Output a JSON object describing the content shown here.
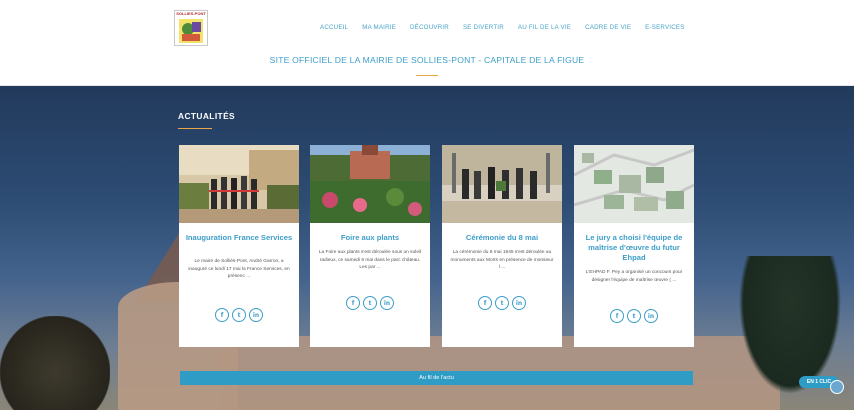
{
  "header": {
    "logo_text": "SOLLIES-PONT",
    "nav": [
      "ACCUEIL",
      "MA MAIRIE",
      "DÉCOUVRIR",
      "SE DIVERTIR",
      "AU FIL DE LA VIE",
      "CADRE DE VIE",
      "E-SERVICES"
    ],
    "site_title": "SITE OFFICIEL DE LA MAIRIE DE SOLLIES-PONT - CAPITALE DE LA FIGUE"
  },
  "news": {
    "section_title": "ACTUALITÉS",
    "cards": [
      {
        "title": "Inauguration France Services",
        "excerpt": "Le maire de Solliès-Pont, André Garron, a inauguré ce lundi 17 mai la France Services, en présenc ...",
        "image": "inauguration-photo"
      },
      {
        "title": "Foire aux plants",
        "excerpt": "La Foire aux plants s'est déroulée sous un soleil radieux, ce samedi 8 mai dans le parc château. Les par ...",
        "image": "garden-photo"
      },
      {
        "title": "Cérémonie du 8 mai",
        "excerpt": "La cérémonie du 8 mai 1945 s'est déroulée au monuments aux Morts en présence de monsieur l ...",
        "image": "ceremony-photo"
      },
      {
        "title": "Le jury a choisi l'équipe de maîtrise d'œuvre du futur Ehpad",
        "excerpt": "L'EHPAD F. Pey a organisé un concours pour désigner l'équipe de maîtrise œuvre ( ...",
        "image": "map-photo"
      }
    ],
    "social": [
      "f",
      "t",
      "in"
    ],
    "more_button": "Au fil de l'actu"
  },
  "widget": {
    "label": "EN 1 CLIC"
  },
  "colors": {
    "accent": "#3e9ec9",
    "underline": "#e8a64a",
    "bar": "#2f9cc6"
  }
}
